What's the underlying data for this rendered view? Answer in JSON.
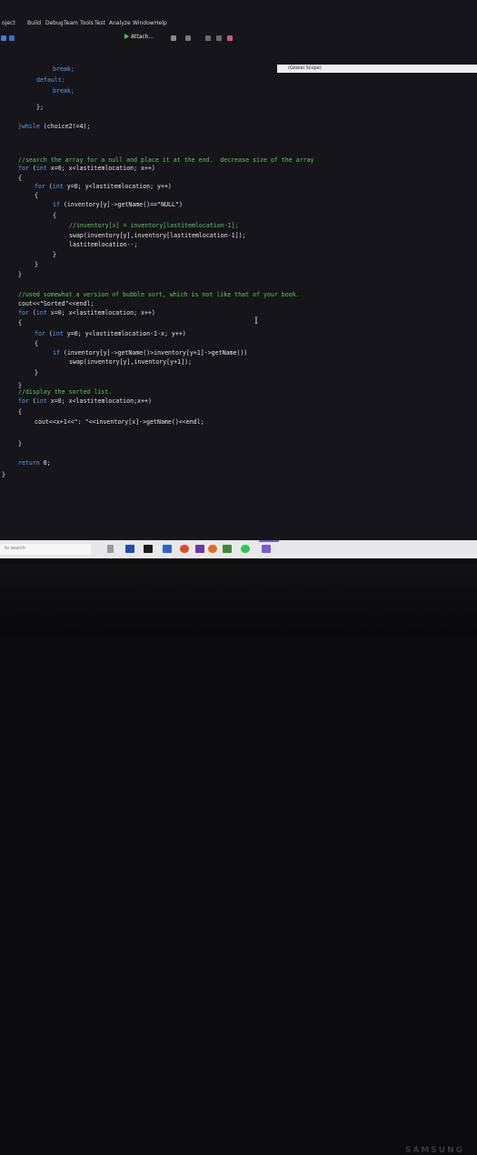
{
  "menu": [
    "oject",
    "Build",
    "Debug",
    "Team",
    "Tools",
    "Test",
    "Analyze",
    "Window",
    "Help"
  ],
  "toolbar": {
    "attach_label": "Attach..."
  },
  "scope": {
    "label": "(Global Scope)"
  },
  "code": {
    "l1": "break;",
    "l2": "default:",
    "l3": "break;",
    "l4": "};",
    "l5a": "}while",
    "l5b": " (choice2!=4);",
    "c1": "//search the array for a null and place it at the end.  decrease size of the array",
    "f1a": "for",
    "f1b": " (",
    "f1c": "int",
    "f1d": " x=0; x<lastitemlocation; x++)",
    "brace_open": "{",
    "brace_close": "}",
    "f2a": "for",
    "f2b": " (",
    "f2c": "int",
    "f2d": " y=0; y<lastitemlocation; y++)",
    "if1a": "if",
    "if1b": " (inventory[y]->getName()==",
    "if1c": "\"NULL\"",
    "if1d": ")",
    "c2": "//inventory[x] = inventory[lastitemlocation-1];",
    "s1": "swap(inventory[y],inventory[lastitemlocation-1]);",
    "s2": "lastitemlocation--;",
    "c3": "//used somewhat a version of bubble sort, which is not like that of your book.",
    "s3a": "cout<<",
    "s3b": "\"Sorted\"",
    "s3c": "<<endl;",
    "f3d": " x=0; x<lastitemlocation; x++)",
    "f4d": " y=0; y<lastitemlocation-1-x; y++)",
    "if2b": " (inventory[y]->getName()>inventory[y+1]->getName())",
    "s4": "swap(inventory[y],inventory[y+1]);",
    "c4": "//display the sorted list.",
    "f5d": " x=0; x<lastitemlocation;x++)",
    "s5a": "cout<<x+1<<",
    "s5b": "\": \"",
    "s5c": "<<inventory[x]->getName()<<endl;",
    "ret_kw": "return",
    "ret_val": " 0;"
  },
  "taskbar": {
    "search_placeholder": "to search"
  },
  "brand": "SAMSUNG",
  "colors": {
    "keyword": "#5a9cf0",
    "comment": "#5ec45e",
    "text": "#e6e6e6",
    "editor_bg": "#16161a"
  }
}
